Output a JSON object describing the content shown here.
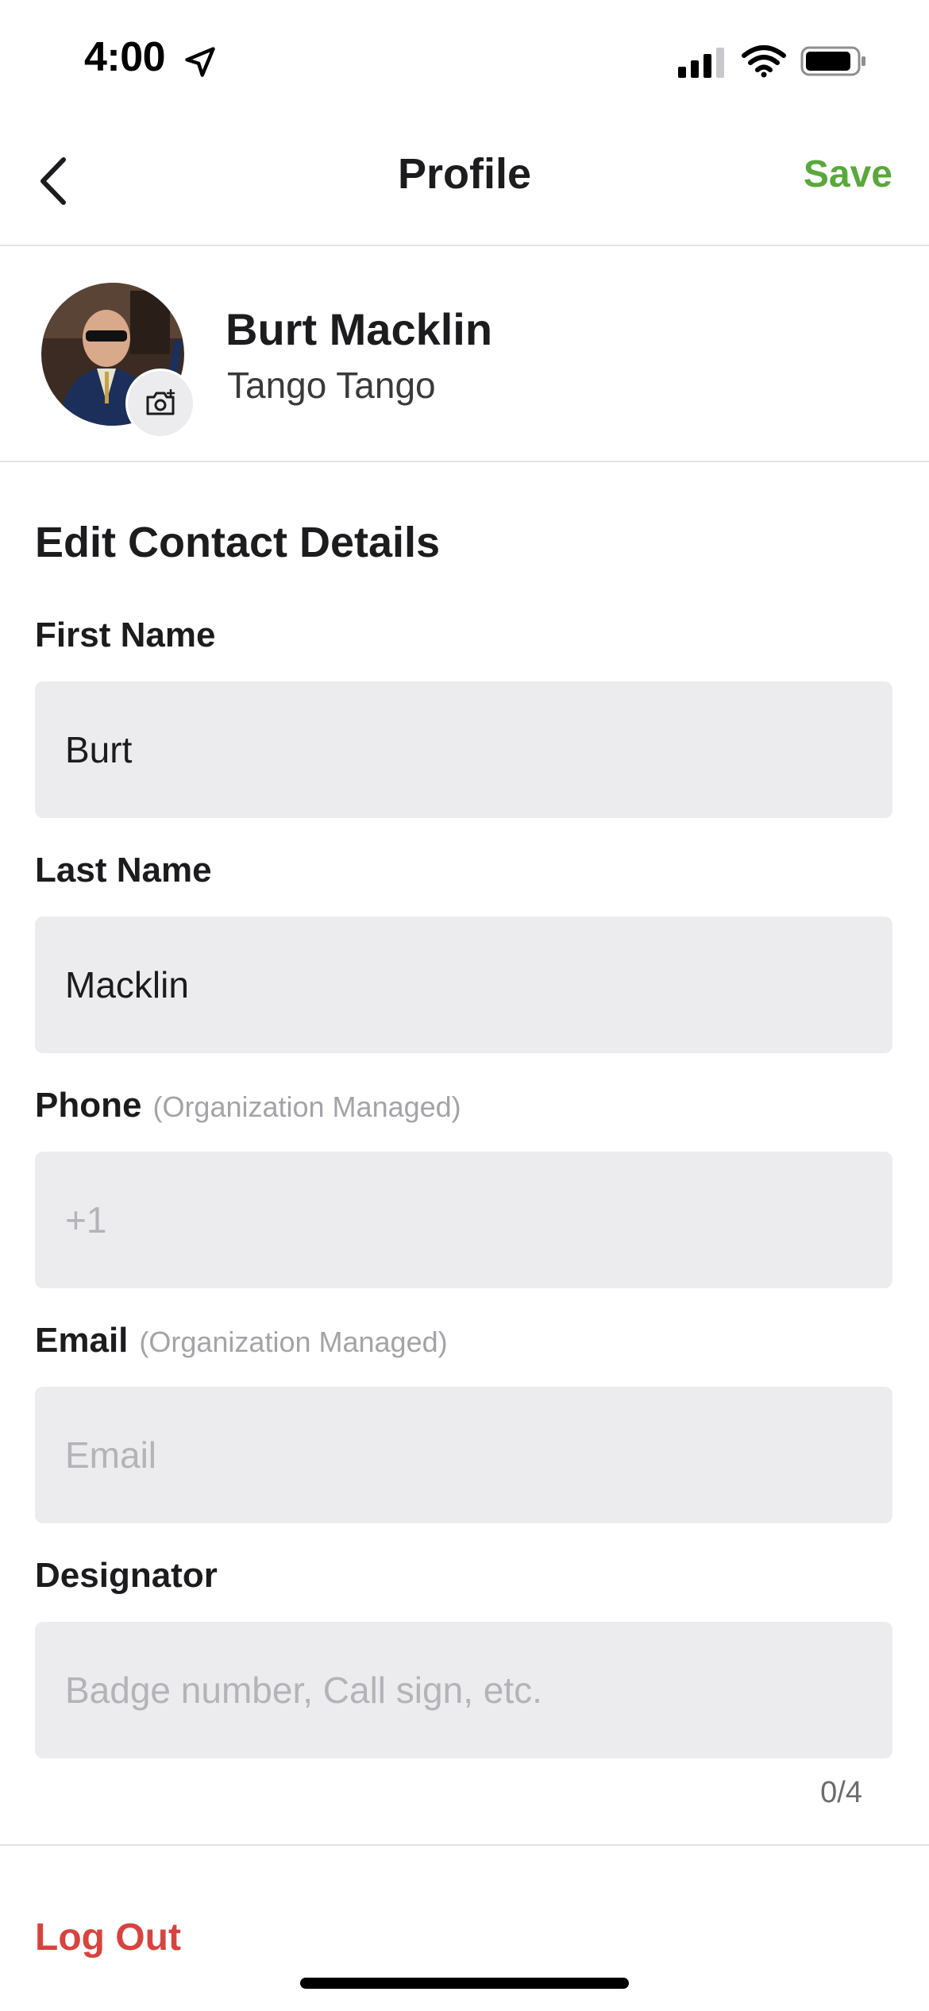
{
  "status_bar": {
    "time": "4:00",
    "icons": [
      "location-arrow-icon",
      "cellular-signal-icon",
      "wifi-icon",
      "battery-icon"
    ]
  },
  "nav": {
    "back_icon": "chevron-left-icon",
    "title": "Profile",
    "save_label": "Save"
  },
  "profile": {
    "name": "Burt Macklin",
    "organization": "Tango Tango",
    "camera_icon": "camera-add-icon"
  },
  "form": {
    "section_title": "Edit Contact Details",
    "fields": [
      {
        "label": "First Name",
        "note": "",
        "value": "Burt",
        "placeholder": ""
      },
      {
        "label": "Last Name",
        "note": "",
        "value": "Macklin",
        "placeholder": ""
      },
      {
        "label": "Phone",
        "note": "(Organization Managed)",
        "value": "",
        "placeholder": "+1"
      },
      {
        "label": "Email",
        "note": "(Organization Managed)",
        "value": "",
        "placeholder": "Email"
      },
      {
        "label": "Designator",
        "note": "",
        "value": "",
        "placeholder": "Badge number, Call sign, etc."
      }
    ],
    "designator_counter": "0/4"
  },
  "logout_label": "Log Out",
  "colors": {
    "accent_green": "#5aa83c",
    "danger_red": "#d6443f",
    "field_background": "#ececee",
    "divider": "#e3e3e6",
    "placeholder_text": "#b3b3b8"
  }
}
